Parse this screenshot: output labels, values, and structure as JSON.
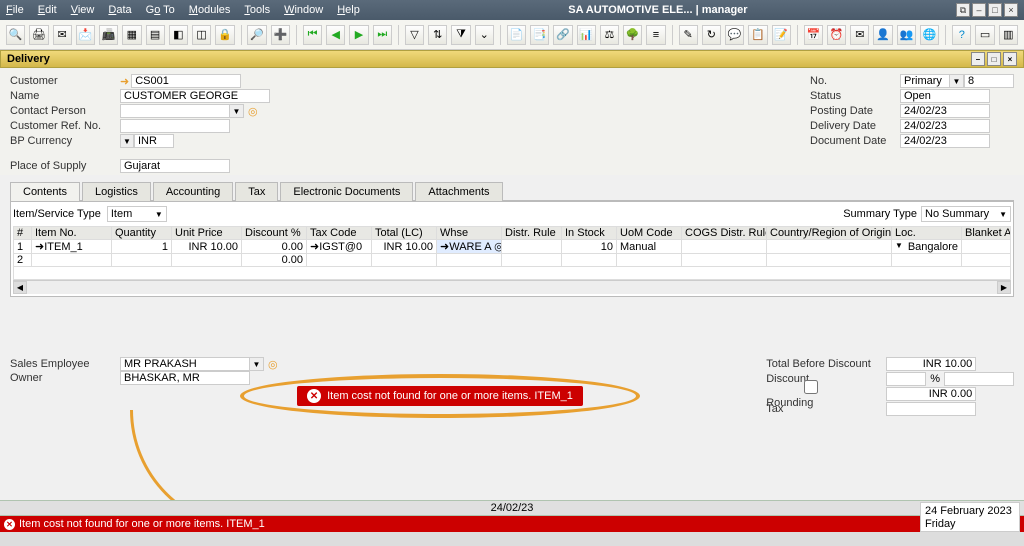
{
  "app_title": "SA AUTOMOTIVE ELE... | manager",
  "menus": [
    "File",
    "Edit",
    "View",
    "Data",
    "Go To",
    "Modules",
    "Tools",
    "Window",
    "Help"
  ],
  "doc_title": "Delivery",
  "customer": {
    "code_label": "Customer",
    "code": "CS001",
    "name_label": "Name",
    "name": "CUSTOMER GEORGE",
    "contact_label": "Contact Person",
    "contact": "",
    "ref_label": "Customer Ref. No.",
    "ref": "",
    "bpcur_label": "BP Currency",
    "bpcur": "INR",
    "pos_label": "Place of Supply",
    "pos": "Gujarat"
  },
  "header_right": {
    "no_label": "No.",
    "series": "Primary",
    "number": "8",
    "status_label": "Status",
    "status": "Open",
    "posting_label": "Posting Date",
    "posting": "24/02/23",
    "delivery_label": "Delivery Date",
    "delivery": "24/02/23",
    "document_label": "Document Date",
    "document": "24/02/23"
  },
  "tabs": [
    "Contents",
    "Logistics",
    "Accounting",
    "Tax",
    "Electronic Documents",
    "Attachments"
  ],
  "grid_toolbar": {
    "type_label": "Item/Service Type",
    "type": "Item",
    "summary_label": "Summary Type",
    "summary": "No Summary"
  },
  "columns": [
    "#",
    "Item No.",
    "Quantity",
    "Unit Price",
    "Discount %",
    "Tax Code",
    "Total (LC)",
    "Whse",
    "Distr. Rule",
    "In Stock",
    "UoM Code",
    "COGS Distr. Rule",
    "Country/Region of Origin",
    "Loc.",
    "Blanket Agreem..."
  ],
  "rows": [
    {
      "n": "1",
      "item": "ITEM_1",
      "qty": "1",
      "price": "INR 10.00",
      "disc": "0.00",
      "tax": "IGST@0",
      "total": "INR 10.00",
      "whse": "WARE A",
      "distr": "",
      "stock": "10",
      "uom": "Manual",
      "cogs": "",
      "country": "",
      "loc": "Bangalore",
      "blanket": ""
    },
    {
      "n": "2",
      "item": "",
      "qty": "",
      "price": "",
      "disc": "0.00",
      "tax": "",
      "total": "",
      "whse": "",
      "distr": "",
      "stock": "",
      "uom": "",
      "cogs": "",
      "country": "",
      "loc": "",
      "blanket": ""
    }
  ],
  "error_msg": "Item cost not found for one or more items.  ITEM_1",
  "status_msg": "Item cost not found for one or more items.  ITEM_1",
  "bottom_left": {
    "sales_label": "Sales Employee",
    "sales": "MR PRAKASH",
    "owner_label": "Owner",
    "owner": "BHASKAR, MR"
  },
  "totals": {
    "tbd_label": "Total Before Discount",
    "tbd": "INR 10.00",
    "disc_label": "Discount",
    "disc_pct": "",
    "pct_sign": "%",
    "disc_amt": "",
    "round_label": "Rounding",
    "round": "INR 0.00",
    "tax_label": "Tax",
    "tax": ""
  },
  "date_strip": "24/02/23",
  "datebox_line1": "24 February 2023",
  "datebox_line2": "Friday"
}
